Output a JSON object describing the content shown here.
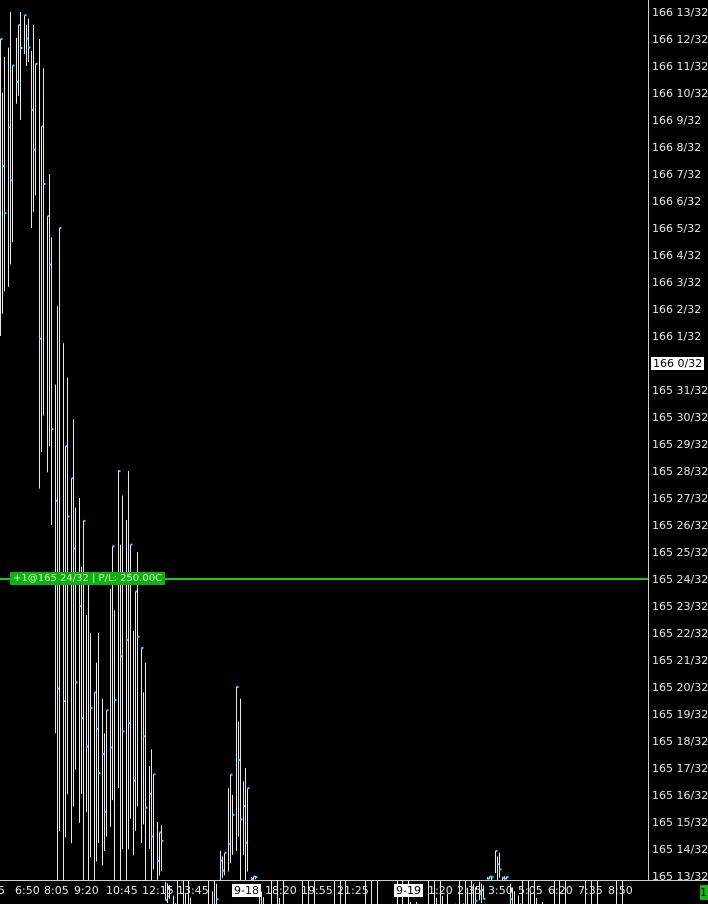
{
  "chart_data": {
    "type": "bar",
    "style": "tick bars (white verticals with cyan close ticks)",
    "y_unit": "32nds (166 13/32 = 166.40625)",
    "y_tick_labels": [
      "166 13/32",
      "166 12/32",
      "166 11/32",
      "166 10/32",
      "166 9/32",
      "166 8/32",
      "166 7/32",
      "166 6/32",
      "166 5/32",
      "166 4/32",
      "166 3/32",
      "166 2/32",
      "166 1/32",
      "166 0/32",
      "165 31/32",
      "165 30/32",
      "165 29/32",
      "165 28/32",
      "165 27/32",
      "165 26/32",
      "165 25/32",
      "165 24/32",
      "165 23/32",
      "165 22/32",
      "165 21/32",
      "165 20/32",
      "165 19/32",
      "165 18/32",
      "165 17/32",
      "165 16/32",
      "165 15/32",
      "165 14/32",
      "165 13/32"
    ],
    "current_price_label": "166 0/32",
    "x_tick_labels": [
      {
        "text": "5",
        "date": false
      },
      {
        "text": "6:50",
        "date": false
      },
      {
        "text": "8:05",
        "date": false
      },
      {
        "text": "9:20",
        "date": false
      },
      {
        "text": "10:45",
        "date": false
      },
      {
        "text": "12:15",
        "date": false
      },
      {
        "text": "13:45",
        "date": false
      },
      {
        "text": "9-18",
        "date": true
      },
      {
        "text": "18:20",
        "date": false
      },
      {
        "text": "19:55",
        "date": false
      },
      {
        "text": "21:25",
        "date": false
      },
      {
        "text": "9-19",
        "date": true
      },
      {
        "text": "1:20",
        "date": false
      },
      {
        "text": "2:35",
        "date": false
      },
      {
        "text": "3:50",
        "date": false
      },
      {
        "text": "5:05",
        "date": false
      },
      {
        "text": "6:20",
        "date": false
      },
      {
        "text": "7:35",
        "date": false
      },
      {
        "text": "8:50",
        "date": false
      }
    ],
    "position_line": {
      "label": "+1@165 24/32 | P/L: 250.00C",
      "price": "165 24/32"
    },
    "series": [
      {
        "values": [
          [
            166.375,
            166.03125
          ],
          [
            166.40625,
            166.0625
          ],
          [
            166.40625,
            166.28125
          ],
          [
            166.40625,
            166.34375
          ],
          [
            166.40625,
            166.15625
          ],
          [
            166.375,
            165.8125
          ],
          [
            166.21875,
            165.8125
          ],
          [
            166.15625,
            165.3125
          ],
          [
            166.0625,
            165.1875
          ],
          [
            165.96875,
            165.09375
          ],
          [
            165.84375,
            165.0625
          ],
          [
            165.75,
            165.15625
          ],
          [
            165.6875,
            165.15625
          ],
          [
            165.625,
            165.15625
          ],
          [
            165.8125,
            165.09375
          ],
          [
            165.875,
            165.03125
          ],
          [
            165.875,
            165.25
          ],
          [
            165.78125,
            165.09375
          ],
          [
            165.6875,
            165.1875
          ],
          [
            165.5625,
            165.28125
          ],
          [
            165.46875,
            165.15625
          ],
          [
            165.375,
            165.09375
          ],
          [
            165.28125,
            164.96875
          ],
          [
            165.1875,
            164.90625
          ],
          [
            165.125,
            164.875
          ],
          [
            165.0,
            164.84375
          ],
          [
            165.15625,
            164.90625
          ],
          [
            165.34375,
            165.0
          ],
          [
            165.4375,
            165.0625
          ],
          [
            165.53125,
            165.15625
          ],
          [
            165.625,
            165.125
          ],
          [
            165.53125,
            165.0625
          ],
          [
            165.40625,
            165.0
          ],
          [
            165.3125,
            164.9375
          ],
          [
            165.1875,
            164.96875
          ],
          [
            165.125,
            165.0
          ],
          [
            165.03125,
            164.96875
          ],
          [
            165.0,
            164.90625
          ],
          [
            165.03125,
            164.9375
          ],
          [
            164.96875,
            164.90625
          ],
          [
            164.90625,
            164.84375
          ],
          [
            164.8125,
            164.6875
          ],
          [
            164.71875,
            164.5625
          ],
          [
            164.71875,
            164.5625
          ],
          [
            164.6875,
            164.59375
          ],
          [
            164.6875,
            164.625
          ],
          [
            164.75,
            164.625
          ],
          [
            164.78125,
            164.65625
          ],
          [
            164.8125,
            164.6875
          ],
          [
            164.875,
            164.75
          ],
          [
            164.9375,
            164.75
          ],
          [
            165.0,
            164.75
          ],
          [
            165.0625,
            164.8125
          ],
          [
            165.0625,
            164.84375
          ],
          [
            165.125,
            164.875
          ],
          [
            165.125,
            164.90625
          ],
          [
            165.15625,
            164.90625
          ],
          [
            165.1875,
            164.96875
          ],
          [
            165.21875,
            165.0
          ],
          [
            165.28125,
            165.0
          ],
          [
            165.34375,
            165.03125
          ],
          [
            165.375,
            165.0625
          ],
          [
            165.40625,
            165.09375
          ],
          [
            165.4375,
            165.125
          ],
          [
            165.40625,
            165.15625
          ],
          [
            165.34375,
            165.1875
          ],
          [
            165.28125,
            165.21875
          ],
          [
            165.21875,
            165.21875
          ],
          [
            165.125,
            165.125
          ],
          [
            165.0625,
            165.03125
          ],
          [
            165.0,
            164.9375
          ],
          [
            164.9375,
            164.875
          ],
          [
            164.90625,
            164.84375
          ],
          [
            164.875,
            164.8125
          ],
          [
            164.84375,
            164.75
          ],
          [
            164.8125,
            164.71875
          ],
          [
            164.75,
            164.6875
          ],
          [
            164.75,
            164.65625
          ],
          [
            164.71875,
            164.625
          ],
          [
            164.71875,
            164.625
          ]
        ]
      }
    ]
  }
}
